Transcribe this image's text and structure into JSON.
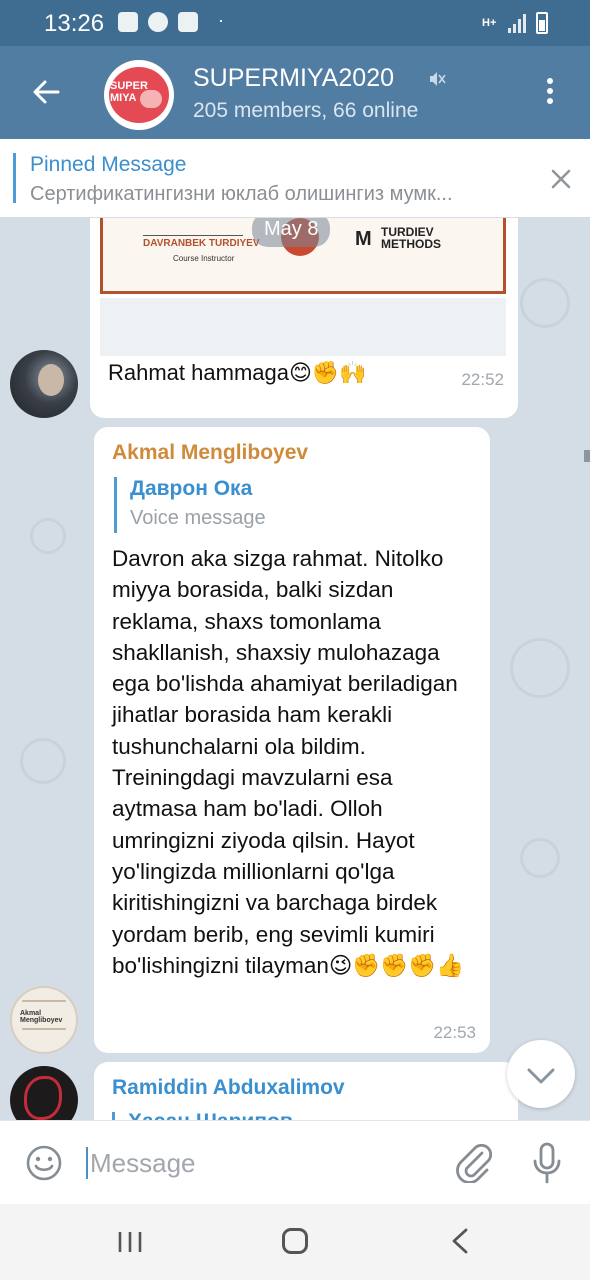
{
  "status_bar": {
    "time": "13:26",
    "dot": "·",
    "network": "H+"
  },
  "header": {
    "avatar_text": "SUPER MIYA",
    "title": "SUPERMIYA2020",
    "subtitle": "205 members, 66 online"
  },
  "pinned": {
    "title": "Pinned Message",
    "text": "Сертификатингизни юклаб олишингиз мумк..."
  },
  "messages": [
    {
      "certificate": {
        "signer_name": "DAVRANBEK TURDIYEV",
        "signer_role": "Course Instructor",
        "logo_text": "TURDIEV METHODS"
      },
      "date_badge": "May 8",
      "text": "Rahmat hammaga😊✊🙌",
      "time": "22:52"
    },
    {
      "sender": "Akmal Mengliboyev",
      "reply": {
        "name": "Даврон Ока",
        "text": "Voice message"
      },
      "text": "Davron aka sizga rahmat. Nitolko miyya borasida, balki sizdan reklama, shaxs tomonlama shakllanish, shaxsiy mulohazaga ega bo'lishda ahamiyat beriladigan jihatlar borasida ham kerakli tushunchalarni ola bildim. Treiningdagi mavzularni esa aytmasa ham bo'ladi. Olloh umringizni ziyoda qilsin. Hayot yo'lingizda millionlarni qo'lga kiritishingizni va barchaga birdek yordam berib, eng sevimli kumiri bo'lishingizni tilayman😉✊✊✊👍",
      "time": "22:53",
      "avatar_text": "Akmal Mengliboyev"
    },
    {
      "sender": "Ramiddin Abduxalimov",
      "reply_name_partial": "Хасан Шарипов"
    }
  ],
  "input": {
    "placeholder": "Message"
  },
  "colors": {
    "header": "#517da2",
    "status_bar": "#3f6d91",
    "accent": "#3a8fce",
    "sender_orange": "#cf8a3a"
  }
}
